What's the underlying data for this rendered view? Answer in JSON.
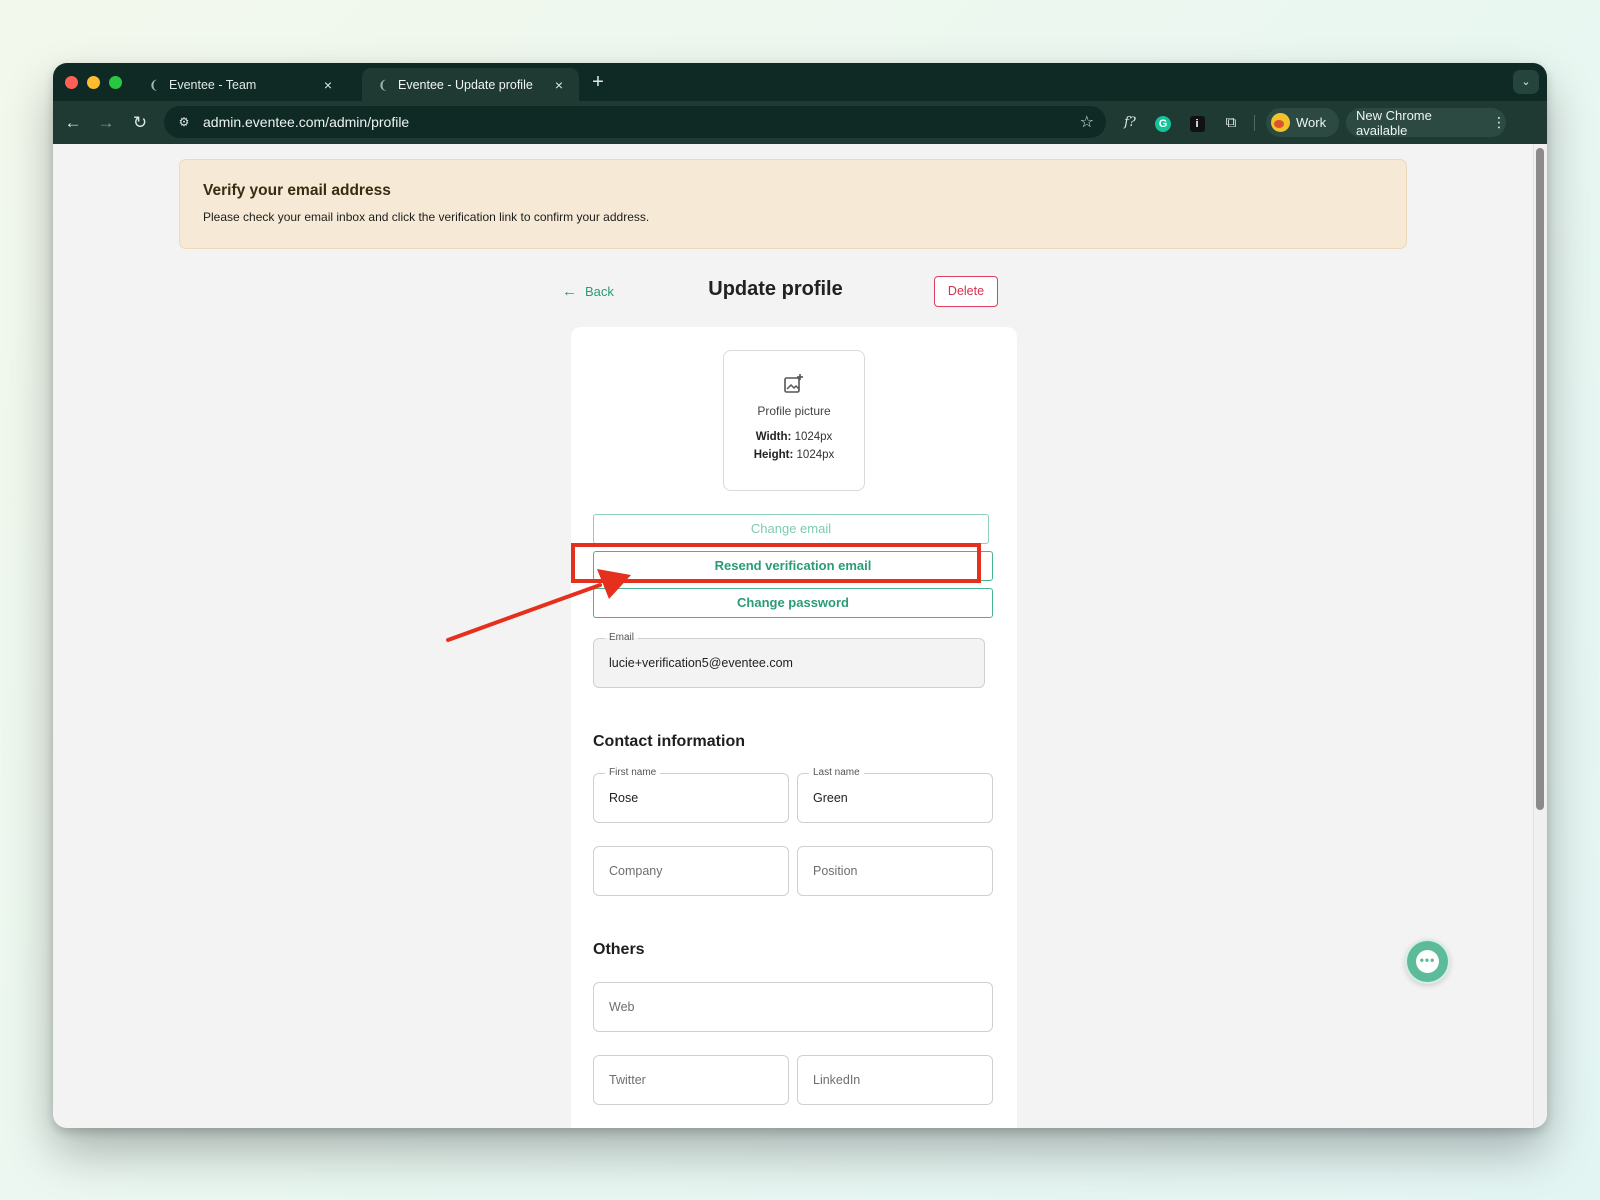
{
  "browser": {
    "tabs": [
      {
        "title": "Eventee - Team",
        "active": false
      },
      {
        "title": "Eventee - Update profile",
        "active": true
      }
    ],
    "new_tab_symbol": "+",
    "close_symbol": "×",
    "url": "admin.eventee.com/admin/profile",
    "profile_label": "Work",
    "update_label": "New Chrome available"
  },
  "banner": {
    "title": "Verify your email address",
    "text": "Please check your email inbox and click the verification link to confirm your address."
  },
  "header": {
    "back_label": "Back",
    "title": "Update profile",
    "delete_label": "Delete"
  },
  "profile_picture": {
    "label": "Profile picture",
    "width_label": "Width:",
    "width_value": "1024px",
    "height_label": "Height:",
    "height_value": "1024px"
  },
  "buttons": {
    "change_email": "Change email",
    "resend_verification": "Resend verification email",
    "change_password": "Change password"
  },
  "email_field": {
    "label": "Email",
    "value": "lucie+verification5@eventee.com"
  },
  "contact": {
    "section_title": "Contact information",
    "first_name_label": "First name",
    "first_name_value": "Rose",
    "last_name_label": "Last name",
    "last_name_value": "Green",
    "company_placeholder": "Company",
    "position_placeholder": "Position"
  },
  "others": {
    "section_title": "Others",
    "web_placeholder": "Web",
    "twitter_placeholder": "Twitter",
    "linkedin_placeholder": "LinkedIn"
  },
  "colors": {
    "brand_green": "#2a9c77",
    "delete_red": "#d6304f",
    "banner_bg": "#f6ead7",
    "annotation_red": "#e4301c"
  }
}
